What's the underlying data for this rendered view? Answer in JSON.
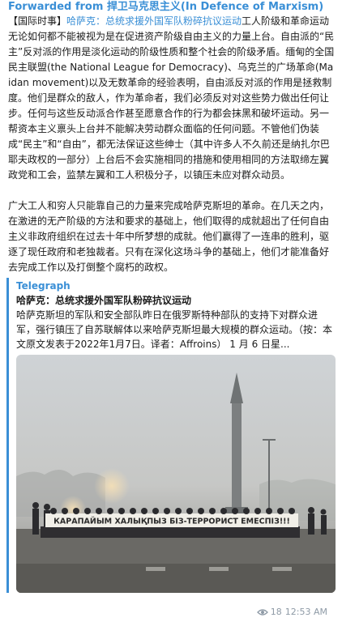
{
  "forward": {
    "prefix": "Forwarded from ",
    "channel": "捍卫马克思主义(In Defence of Marxism)"
  },
  "message": {
    "tag": "【国际时事】",
    "headline": "哈萨克：总统求援外国军队粉碎抗议运动",
    "para1": "工人阶级和革命运动无论如何都不能被视为是在促进资产阶级自由主义的力量上台。自由派的“民主”反对派的作用是淡化运动的阶级性质和整个社会的阶级矛盾。缅甸的全国民主联盟(the National League for Democracy)、乌克兰的广场革命(Maidan movement)以及无数革命的经验表明，自由派反对派的作用是拯救制度。他们是群众的敌人，作为革命者，我们必须反对对这些势力做出任何让步。任何与这些反动派合作甚至愿意合作的行为都会抹黑和破坏运动。另一帮资本主义禀头上台并不能解决劳动群众面临的任何问题。不管他们伪装成“民主”和“自由”，都无法保证这些绅士（其中许多人不久前还是纳扎尔巴耶夫政权的一部分）上台后不会实施相同的措施和使用相同的方法取缔左翼政党和工会，监禁左翼和工人积极分子，以镇压未应对群众动员。",
    "para2": "广大工人和穷人只能靠自己的力量来完成哈萨克斯坦的革命。在几天之内，在激进的无产阶级的方法和要求的基础上，他们取得的成就超出了任何自由主义非政府组织在过去十年中所梦想的成就。他们赢得了一连串的胜利，驱逐了现任政府和老独裁者。只有在深化这场斗争的基础上，他们才能准备好去完成工作以及打倒整个腐朽的政权。"
  },
  "preview": {
    "site": "Telegraph",
    "title": "哈萨克：总统求援外国军队粉碎抗议运动",
    "description": "哈萨克斯坦的军队和安全部队昨日在俄罗斯特种部队的支持下对群众进军，强行镇压了自苏联解体以来哈萨克斯坦最大规模的群众运动。（按：本文原文发表于2022年1月7日。译者：Affroins） 1 月 6 日星...",
    "banner": "КАРАПАЙЫМ ХАЛЫҚПЫЗ БІЗ-ТЕРРОРИСТ ЕМЕСПІЗ!!!"
  },
  "meta": {
    "views": "18",
    "time": "12:53 AM",
    "icon": "eye-icon"
  },
  "colors": {
    "accent": "#3a8fd6",
    "meta": "#8e9aa6"
  }
}
